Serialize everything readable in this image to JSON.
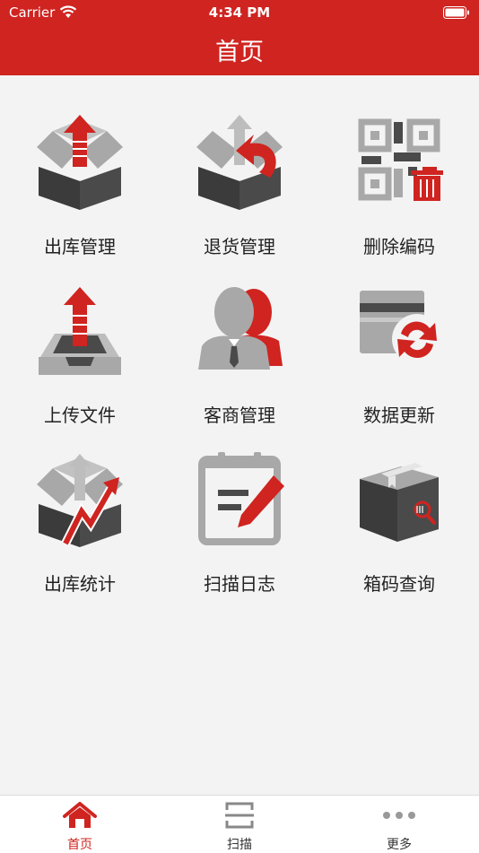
{
  "status_bar": {
    "carrier": "Carrier",
    "time": "4:34 PM"
  },
  "header": {
    "title": "首页"
  },
  "menu": [
    {
      "label": "出库管理",
      "icon": "outbound-box-icon"
    },
    {
      "label": "退货管理",
      "icon": "return-box-icon"
    },
    {
      "label": "删除编码",
      "icon": "qr-delete-icon"
    },
    {
      "label": "上传文件",
      "icon": "upload-tray-icon"
    },
    {
      "label": "客商管理",
      "icon": "customers-icon"
    },
    {
      "label": "数据更新",
      "icon": "card-refresh-icon"
    },
    {
      "label": "出库统计",
      "icon": "outbound-stats-icon"
    },
    {
      "label": "扫描日志",
      "icon": "scan-log-icon"
    },
    {
      "label": "箱码查询",
      "icon": "box-search-icon"
    }
  ],
  "tabbar": {
    "items": [
      {
        "label": "首页",
        "icon": "home-icon",
        "active": true
      },
      {
        "label": "扫描",
        "icon": "scan-icon",
        "active": false
      },
      {
        "label": "更多",
        "icon": "more-icon",
        "active": false
      }
    ]
  },
  "colors": {
    "accent": "#cf2420",
    "dark_gray": "#4a4a4a",
    "mid_gray": "#a8a8a8",
    "background": "#f3f3f3"
  }
}
